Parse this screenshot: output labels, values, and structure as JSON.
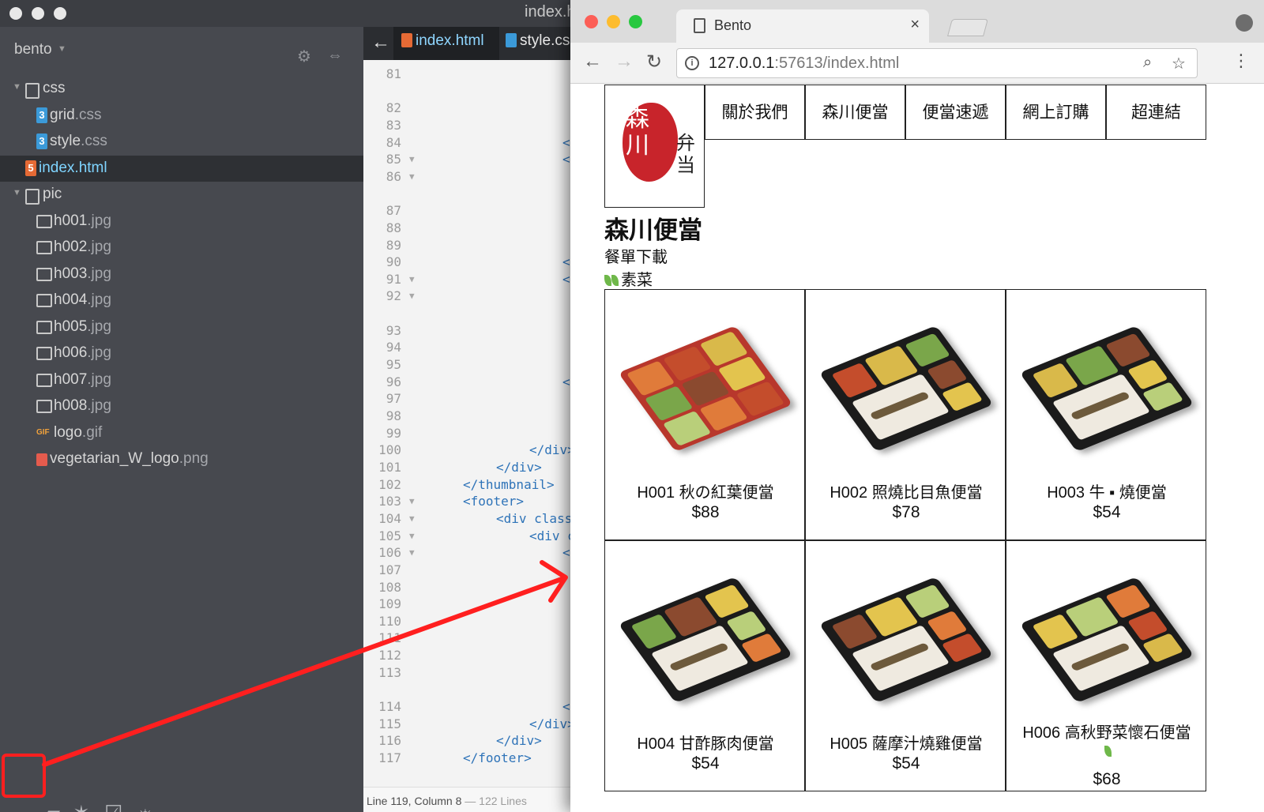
{
  "editor": {
    "window_title": "index.ht",
    "project": "bento",
    "tree": [
      {
        "type": "folder",
        "name": "css",
        "ext": "",
        "depth": 0,
        "icon": "folder-icon"
      },
      {
        "type": "css",
        "name": "grid",
        "ext": ".css",
        "depth": 1,
        "icon": "css-file-icon"
      },
      {
        "type": "css",
        "name": "style",
        "ext": ".css",
        "depth": 1,
        "icon": "css-file-icon"
      },
      {
        "type": "html",
        "name": "index",
        "ext": ".html",
        "depth": 0,
        "icon": "html-file-icon",
        "selected": true
      },
      {
        "type": "folder",
        "name": "pic",
        "ext": "",
        "depth": 0,
        "icon": "folder-icon"
      },
      {
        "type": "img",
        "name": "h001",
        "ext": ".jpg",
        "depth": 1,
        "icon": "image-file-icon"
      },
      {
        "type": "img",
        "name": "h002",
        "ext": ".jpg",
        "depth": 1,
        "icon": "image-file-icon"
      },
      {
        "type": "img",
        "name": "h003",
        "ext": ".jpg",
        "depth": 1,
        "icon": "image-file-icon"
      },
      {
        "type": "img",
        "name": "h004",
        "ext": ".jpg",
        "depth": 1,
        "icon": "image-file-icon"
      },
      {
        "type": "img",
        "name": "h005",
        "ext": ".jpg",
        "depth": 1,
        "icon": "image-file-icon"
      },
      {
        "type": "img",
        "name": "h006",
        "ext": ".jpg",
        "depth": 1,
        "icon": "image-file-icon"
      },
      {
        "type": "img",
        "name": "h007",
        "ext": ".jpg",
        "depth": 1,
        "icon": "image-file-icon"
      },
      {
        "type": "img",
        "name": "h008",
        "ext": ".jpg",
        "depth": 1,
        "icon": "image-file-icon"
      },
      {
        "type": "gif",
        "name": "logo",
        "ext": ".gif",
        "depth": 1,
        "icon": "gif-file-icon"
      },
      {
        "type": "png",
        "name": "vegetarian_W_logo",
        "ext": ".png",
        "depth": 1,
        "icon": "png-file-icon"
      }
    ],
    "tabs": [
      {
        "name": "index",
        "ext": ".html",
        "active": true
      },
      {
        "name": "style",
        "ext": ".css",
        "active": false
      }
    ],
    "code_lines": [
      {
        "n": "81",
        "fold": false,
        "text": ""
      },
      {
        "n": "",
        "fold": false,
        "text": ""
      },
      {
        "n": "82",
        "fold": false,
        "text": ""
      },
      {
        "n": "83",
        "fold": false,
        "text": ""
      },
      {
        "n": "84",
        "fold": false,
        "text": "</"
      },
      {
        "n": "85",
        "fold": true,
        "text": "<d"
      },
      {
        "n": "86",
        "fold": true,
        "text": ""
      },
      {
        "n": "",
        "fold": false,
        "text": ""
      },
      {
        "n": "87",
        "fold": false,
        "text": ""
      },
      {
        "n": "88",
        "fold": false,
        "text": ""
      },
      {
        "n": "89",
        "fold": false,
        "text": ""
      },
      {
        "n": "90",
        "fold": false,
        "text": "</"
      },
      {
        "n": "91",
        "fold": true,
        "text": "<d"
      },
      {
        "n": "92",
        "fold": true,
        "text": ""
      },
      {
        "n": "",
        "fold": false,
        "text": ""
      },
      {
        "n": "93",
        "fold": false,
        "text": ""
      },
      {
        "n": "94",
        "fold": false,
        "text": ""
      },
      {
        "n": "95",
        "fold": false,
        "text": ""
      },
      {
        "n": "96",
        "fold": false,
        "text": "</"
      },
      {
        "n": "97",
        "fold": false,
        "text": ""
      },
      {
        "n": "98",
        "fold": false,
        "text": ""
      },
      {
        "n": "99",
        "fold": false,
        "text": ""
      },
      {
        "n": "100",
        "fold": false,
        "text": "</div>"
      },
      {
        "n": "101",
        "fold": false,
        "text": "</div>"
      },
      {
        "n": "102",
        "fold": false,
        "text": "</thumbnail>"
      },
      {
        "n": "103",
        "fold": true,
        "text": "<footer>"
      },
      {
        "n": "104",
        "fold": true,
        "text": "<div class"
      },
      {
        "n": "105",
        "fold": true,
        "text": "<div c"
      },
      {
        "n": "106",
        "fold": true,
        "text": "<d"
      },
      {
        "n": "107",
        "fold": false,
        "text": ""
      },
      {
        "n": "108",
        "fold": false,
        "text": ""
      },
      {
        "n": "109",
        "fold": false,
        "text": ""
      },
      {
        "n": "110",
        "fold": false,
        "text": ""
      },
      {
        "n": "111",
        "fold": false,
        "text": ""
      },
      {
        "n": "112",
        "fold": false,
        "text": ""
      },
      {
        "n": "113",
        "fold": false,
        "text": ""
      },
      {
        "n": "",
        "fold": false,
        "text": ""
      },
      {
        "n": "114",
        "fold": false,
        "text": "</"
      },
      {
        "n": "115",
        "fold": false,
        "text": "</div>"
      },
      {
        "n": "116",
        "fold": false,
        "text": "</div>"
      },
      {
        "n": "117",
        "fold": false,
        "text": "</footer>"
      }
    ],
    "status": {
      "position": "Line 119, Column 8",
      "lines": "122 Lines",
      "separator": " — "
    },
    "bottom_icons": [
      "live-preview-icon",
      "extension-icon",
      "magic-wand-icon",
      "checkbox-icon",
      "lightbulb-icon"
    ]
  },
  "browser": {
    "tab_title": "Bento",
    "url_host": "127.0.0.1",
    "url_rest": ":57613/index.html",
    "page": {
      "nav": [
        "關於我們",
        "森川便當",
        "便當速遞",
        "網上訂購",
        "超連結"
      ],
      "title": "森川便當",
      "menu_download": "餐單下載",
      "veg_label": "素菜",
      "items": [
        {
          "code": "H001",
          "name": "秋の紅葉便當",
          "price": "$88",
          "veg": false,
          "tray": "red"
        },
        {
          "code": "H002",
          "name": "照燒比目魚便當",
          "price": "$78",
          "veg": false,
          "tray": "black"
        },
        {
          "code": "H003",
          "name": "牛 ▪ 燒便當",
          "price": "$54",
          "veg": false,
          "tray": "black"
        },
        {
          "code": "H004",
          "name": "甘酢豚肉便當",
          "price": "$54",
          "veg": false,
          "tray": "black"
        },
        {
          "code": "H005",
          "name": "薩摩汁燒雞便當",
          "price": "$54",
          "veg": false,
          "tray": "black"
        },
        {
          "code": "H006",
          "name": "高秋野菜懷石便當",
          "price": "$68",
          "veg": true,
          "tray": "black"
        }
      ]
    }
  },
  "colors": {
    "highlight": "#ff1f1f",
    "accent_blue": "#7fd4ff",
    "logo_red": "#c8242b"
  }
}
